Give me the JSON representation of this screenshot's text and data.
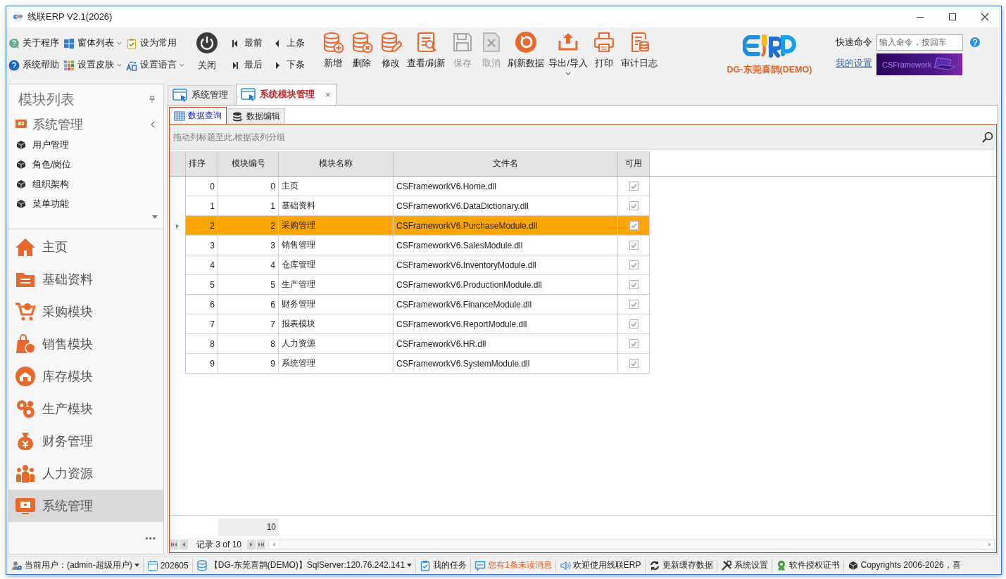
{
  "window": {
    "title": "线联ERP V2.1(2026)"
  },
  "toolbar": {
    "small_buttons": [
      {
        "label": "关于程序",
        "dropdown": false
      },
      {
        "label": "窗体列表",
        "dropdown": true
      },
      {
        "label": "设为常用",
        "dropdown": false
      },
      {
        "label": "系统帮助",
        "dropdown": false
      },
      {
        "label": "设置皮肤",
        "dropdown": true
      },
      {
        "label": "设置语言",
        "dropdown": true
      }
    ],
    "close_button": "关闭",
    "nav_buttons": [
      "最前",
      "上条",
      "最后",
      "下条"
    ],
    "big_buttons": [
      {
        "label": "新增",
        "disabled": false,
        "dropdown": false
      },
      {
        "label": "删除",
        "disabled": false,
        "dropdown": false
      },
      {
        "label": "修改",
        "disabled": false,
        "dropdown": false
      },
      {
        "label": "查看/刷新",
        "disabled": false,
        "dropdown": false
      },
      {
        "label": "保存",
        "disabled": true,
        "dropdown": false
      },
      {
        "label": "取消",
        "disabled": true,
        "dropdown": false
      },
      {
        "label": "刷新数据",
        "disabled": false,
        "dropdown": false
      },
      {
        "label": "导出/导入",
        "disabled": false,
        "dropdown": true
      },
      {
        "label": "打印",
        "disabled": false,
        "dropdown": false
      },
      {
        "label": "审计日志",
        "disabled": false,
        "dropdown": false
      }
    ],
    "company": "DG-东莞喜鹊(DEMO)",
    "quick_command": {
      "label": "快速命令",
      "placeholder": "输入命令，按回车"
    },
    "settings_link": "我的设置",
    "banner": "CSFramework"
  },
  "sidebar": {
    "title": "模块列表",
    "group": {
      "label": "系统管理",
      "expanded": true,
      "items": [
        "用户管理",
        "角色/岗位",
        "组织架构",
        "菜单功能"
      ]
    },
    "modules": [
      {
        "label": "主页",
        "selected": false
      },
      {
        "label": "基础资料",
        "selected": false
      },
      {
        "label": "采购模块",
        "selected": false
      },
      {
        "label": "销售模块",
        "selected": false
      },
      {
        "label": "库存模块",
        "selected": false
      },
      {
        "label": "生产模块",
        "selected": false
      },
      {
        "label": "财务管理",
        "selected": false
      },
      {
        "label": "人力资源",
        "selected": false
      },
      {
        "label": "系统管理",
        "selected": true
      }
    ],
    "more": "•••"
  },
  "tabs": [
    {
      "label": "系统管理",
      "selected": false
    },
    {
      "label": "系统模块管理",
      "selected": true,
      "close": "×"
    }
  ],
  "subtabs": [
    {
      "label": "数据查询",
      "selected": true
    },
    {
      "label": "数据编辑",
      "selected": false
    }
  ],
  "group_panel": "拖动列标题至此,根据该列分组",
  "table": {
    "columns": [
      "排序",
      "模块编号",
      "模块名称",
      "文件名",
      "可用"
    ],
    "rows": [
      {
        "cells": [
          "0",
          "0",
          "主页",
          "CSFrameworkV6.Home.dll"
        ],
        "enabled": true,
        "selected": false
      },
      {
        "cells": [
          "1",
          "1",
          "基础资料",
          "CSFrameworkV6.DataDictionary.dll"
        ],
        "enabled": true,
        "selected": false
      },
      {
        "cells": [
          "2",
          "2",
          "采购管理",
          "CSFrameworkV6.PurchaseModule.dll"
        ],
        "enabled": true,
        "selected": true
      },
      {
        "cells": [
          "3",
          "3",
          "销售管理",
          "CSFrameworkV6.SalesModule.dll"
        ],
        "enabled": true,
        "selected": false
      },
      {
        "cells": [
          "4",
          "4",
          "仓库管理",
          "CSFrameworkV6.InventoryModule.dll"
        ],
        "enabled": true,
        "selected": false
      },
      {
        "cells": [
          "5",
          "5",
          "生产管理",
          "CSFrameworkV6.ProductionModule.dll"
        ],
        "enabled": true,
        "selected": false
      },
      {
        "cells": [
          "6",
          "6",
          "财务管理",
          "CSFrameworkV6.FinanceModule.dll"
        ],
        "enabled": true,
        "selected": false
      },
      {
        "cells": [
          "7",
          "7",
          "报表模块",
          "CSFrameworkV6.ReportModule.dll"
        ],
        "enabled": true,
        "selected": false
      },
      {
        "cells": [
          "8",
          "8",
          "人力资源",
          "CSFrameworkV6.HR.dll"
        ],
        "enabled": true,
        "selected": false
      },
      {
        "cells": [
          "9",
          "9",
          "系统管理",
          "CSFrameworkV6.SystemModule.dll"
        ],
        "enabled": true,
        "selected": false
      }
    ],
    "footer_count": "10",
    "record_info": "记录 3 of 10"
  },
  "status_bar": [
    {
      "text": "当前用户：(admin-超级用户)",
      "dropdown": true,
      "alert": false
    },
    {
      "text": "202605",
      "dropdown": false,
      "alert": false
    },
    {
      "text": "【DG-东莞喜鹊(DEMO)】SqlServer:120.76.242.141",
      "dropdown": true,
      "alert": false
    },
    {
      "text": "我的任务",
      "dropdown": false,
      "alert": false
    },
    {
      "text": "您有1条未读消息",
      "dropdown": false,
      "alert": true
    },
    {
      "text": "欢迎使用线联ERP",
      "dropdown": false,
      "alert": false
    },
    {
      "text": "更新缓存数据",
      "dropdown": false,
      "alert": false
    },
    {
      "text": "系统设置",
      "dropdown": false,
      "alert": false
    },
    {
      "text": "软件授权证书",
      "dropdown": false,
      "alert": false
    },
    {
      "text": "Copyrights 2006-2026，喜",
      "dropdown": false,
      "alert": false
    }
  ]
}
